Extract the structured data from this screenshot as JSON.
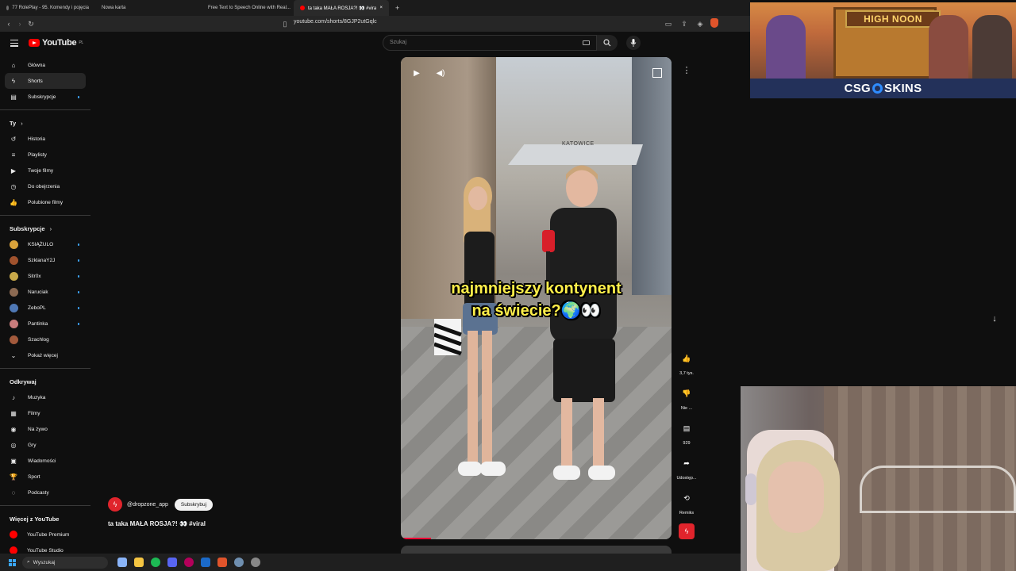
{
  "browser": {
    "tabs": [
      {
        "label": "77 RolePlay - 95. Komendy i pojęcia",
        "color": "#6f6f6f"
      },
      {
        "label": "Nowa karta",
        "color": "#6f6f6f"
      },
      {
        "label": "Free Text to Speech Online with Real...",
        "color": "#3a6df0"
      },
      {
        "label": "ta taka MAŁA ROSJA?! 👀 #viral",
        "color": "#ff0000"
      }
    ],
    "url": "youtube.com/shorts/8GJP2utGqlc",
    "new_tab_symbol": "+",
    "close_symbol": "×"
  },
  "youtube": {
    "logo_text": "YouTube",
    "logo_region": "PL",
    "search_placeholder": "Szukaj"
  },
  "sidebar": {
    "main": [
      {
        "label": "Główna",
        "icon": "home-icon",
        "glyph": "⌂"
      },
      {
        "label": "Shorts",
        "icon": "shorts-icon",
        "glyph": "ϟ",
        "active": true
      },
      {
        "label": "Subskrypcje",
        "icon": "subscriptions-icon",
        "glyph": "▤",
        "dot": true
      }
    ],
    "you_header": "Ty",
    "you": [
      {
        "label": "Historia",
        "icon": "history-icon",
        "glyph": "↺"
      },
      {
        "label": "Playlisty",
        "icon": "playlists-icon",
        "glyph": "≡"
      },
      {
        "label": "Twoje filmy",
        "icon": "your-videos-icon",
        "glyph": "▶"
      },
      {
        "label": "Do obejrzenia",
        "icon": "watch-later-icon",
        "glyph": "◷"
      },
      {
        "label": "Polubione filmy",
        "icon": "liked-icon",
        "glyph": "👍"
      }
    ],
    "subs_header": "Subskrypcje",
    "subs": [
      {
        "label": "KSIĄŻULO",
        "color": "#d9a23b"
      },
      {
        "label": "SzklanaY2J",
        "color": "#a0522d"
      },
      {
        "label": "Sitr0x",
        "color": "#c8a94a"
      },
      {
        "label": "Naruciak",
        "color": "#8c6a52"
      },
      {
        "label": "ZeboPL",
        "color": "#4f78b5"
      },
      {
        "label": "Pantinka",
        "color": "#c97c7c"
      },
      {
        "label": "Szachlog",
        "color": "#a35a3c"
      }
    ],
    "show_more": "Pokaż więcej",
    "explore_header": "Odkrywaj",
    "explore": [
      {
        "label": "Muzyka",
        "icon": "music-icon",
        "glyph": "♪"
      },
      {
        "label": "Filmy",
        "icon": "movies-icon",
        "glyph": "▦"
      },
      {
        "label": "Na żywo",
        "icon": "live-icon",
        "glyph": "◉"
      },
      {
        "label": "Gry",
        "icon": "gaming-icon",
        "glyph": "◎"
      },
      {
        "label": "Wiadomości",
        "icon": "news-icon",
        "glyph": "▣"
      },
      {
        "label": "Sport",
        "icon": "sport-icon",
        "glyph": "🏆"
      },
      {
        "label": "Podcasty",
        "icon": "podcasts-icon",
        "glyph": "◌"
      }
    ],
    "more_header": "Więcej z YouTube",
    "more": [
      {
        "label": "YouTube Premium",
        "color": "#ff0000"
      },
      {
        "label": "YouTube Studio",
        "color": "#ff0000"
      }
    ]
  },
  "video": {
    "caption_line1": "najmniejszy kontynent",
    "caption_line2": "na świecie?🌍👀",
    "sign_text": "KATOWICE",
    "channel": "@dropzone_app",
    "subscribe_label": "Subskrybuj",
    "title": "ta taka MAŁA ROSJA?! 👀 #viral",
    "progress": 0.11
  },
  "actions": [
    {
      "name": "like",
      "glyph": "👍",
      "label": "3,7 tys."
    },
    {
      "name": "dislike",
      "glyph": "👎",
      "label": "Nie ..."
    },
    {
      "name": "comments",
      "glyph": "▤",
      "label": "929"
    },
    {
      "name": "share",
      "glyph": "➦",
      "label": "Udostęp..."
    },
    {
      "name": "remix",
      "glyph": "⟲",
      "label": "Remiks"
    }
  ],
  "ad": {
    "sign_text": "HIGH NOON",
    "brand_left": "CSG",
    "brand_right": "SKINS"
  },
  "taskbar": {
    "search_label": "Wyszukaj",
    "icon_colors": [
      "#8ab4f8",
      "#f5c542",
      "#1db954",
      "#5865f2",
      "#b4005a",
      "#1b6ac9",
      "#e0542b",
      "#6f8fb0",
      "#888888"
    ]
  },
  "colors": {
    "accent": "#ff0000",
    "caption": "#ffef4a",
    "link": "#3ea6ff"
  }
}
